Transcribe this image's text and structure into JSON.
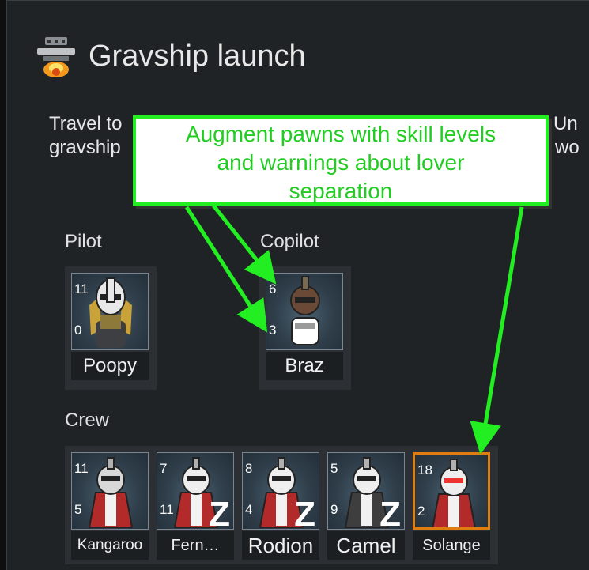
{
  "dialog": {
    "title": "Gravship launch",
    "description_lines": [
      "Travel to",
      "gravship"
    ],
    "description_right": [
      "Un",
      "u wo"
    ]
  },
  "callout": {
    "lines": [
      "Augment pawns with skill levels",
      "and warnings about lover",
      "separation"
    ]
  },
  "sections": {
    "pilot_label": "Pilot",
    "copilot_label": "Copilot",
    "crew_label": "Crew"
  },
  "pilot": {
    "name": "Poopy",
    "skill_top": "11",
    "skill_bottom": "0"
  },
  "copilot": {
    "name": "Braz",
    "skill_top": "6",
    "skill_bottom": "3"
  },
  "crew": [
    {
      "name": "Kangaroo",
      "skill_top": "11",
      "skill_bottom": "5",
      "sleeping": false,
      "selected": false
    },
    {
      "name": "Fern…",
      "skill_top": "7",
      "skill_bottom": "11",
      "sleeping": true,
      "selected": false
    },
    {
      "name": "Rodion",
      "skill_top": "8",
      "skill_bottom": "4",
      "sleeping": true,
      "selected": false
    },
    {
      "name": "Camel",
      "skill_top": "5",
      "skill_bottom": "9",
      "sleeping": true,
      "selected": false
    },
    {
      "name": "Solange",
      "skill_top": "18",
      "skill_bottom": "2",
      "sleeping": false,
      "selected": true
    }
  ],
  "sleep_glyph": "Z",
  "colors": {
    "callout_green": "#22ee22",
    "selected_border": "#e07d10"
  }
}
